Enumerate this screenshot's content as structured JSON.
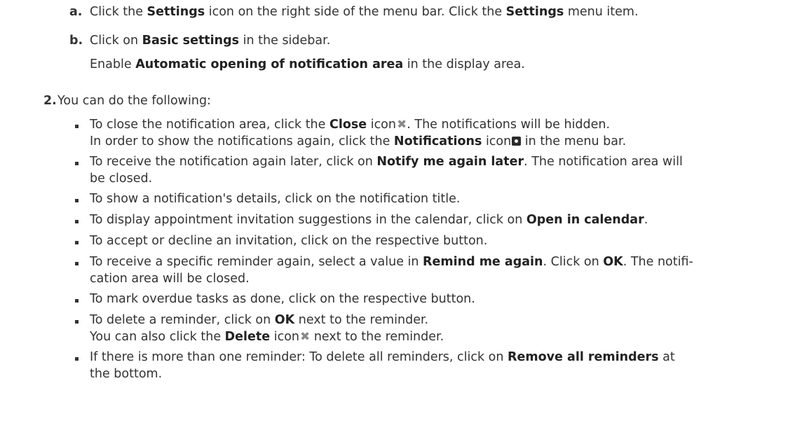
{
  "steps": {
    "a_marker": "a.",
    "a_t1": "Click the ",
    "a_b1": "Settings",
    "a_t2": " icon on the right side of the menu bar. Click the ",
    "a_b2": "Settings",
    "a_t3": " menu item.",
    "b_marker": "b.",
    "b_t1": "Click on ",
    "b_b1": "Basic settings",
    "b_t2": " in the sidebar.",
    "b2_t1": "Enable ",
    "b2_b1": "Automatic opening of notification area",
    "b2_t2": " in the display area.",
    "s2_marker": "2.",
    "s2_text": "You can do the following:"
  },
  "bullets": {
    "i1_t1": "To close the notification area, click the ",
    "i1_b1": "Close",
    "i1_t2": " icon",
    "i1_t3": ". The notifications will be hidden.",
    "i1b_t1": "In order to show the notifications again, click the ",
    "i1b_b1": "Notifications",
    "i1b_t2": " icon",
    "i1b_t3": " in the menu bar.",
    "i2_t1": "To receive the notification again later, click on ",
    "i2_b1": "Notify me again later",
    "i2_t2": ". The notification area will",
    "i2b_t1": "be closed.",
    "i3_t1": "To show a notification's details, click on the notification title.",
    "i4_t1": "To display appointment invitation suggestions in the calendar, click on ",
    "i4_b1": "Open in calendar",
    "i4_t2": ".",
    "i5_t1": "To accept or decline an invitation, click on the respective button.",
    "i6_t1": "To receive a specific reminder again, select a value in ",
    "i6_b1": "Remind me again",
    "i6_t2": ". Click on ",
    "i6_b2": "OK",
    "i6_t3": ". The notifi-",
    "i6b_t1": "cation area will be closed.",
    "i7_t1": "To mark overdue tasks as done, click on the respective button.",
    "i8_t1": "To delete a reminder, click on ",
    "i8_b1": "OK",
    "i8_t2": " next to the reminder.",
    "i8b_t1": "You can also click the ",
    "i8b_b1": "Delete",
    "i8b_t2": " icon",
    "i8b_t3": " next to the reminder.",
    "i9_t1": "If there is more than one reminder: To delete all reminders, click on ",
    "i9_b1": "Remove all reminders",
    "i9_t2": " at",
    "i9b_t1": "the bottom."
  },
  "icons": {
    "close": "close-icon",
    "notifications": "notifications-icon",
    "delete": "delete-icon"
  }
}
